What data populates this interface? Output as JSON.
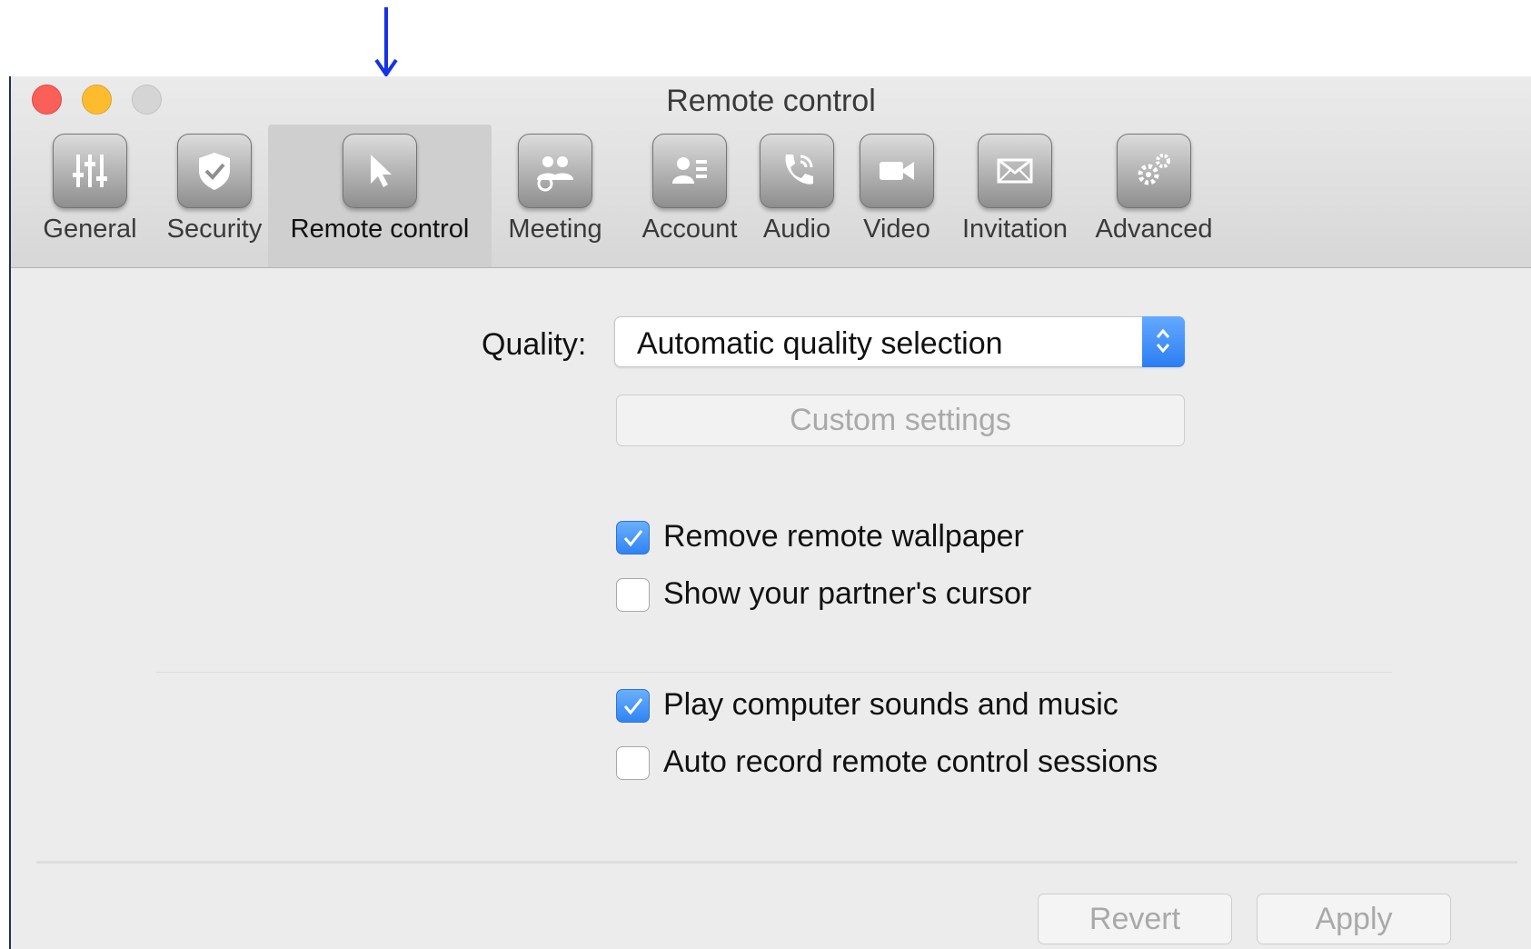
{
  "window": {
    "title": "Remote control"
  },
  "toolbar": {
    "items": [
      {
        "label": "General",
        "icon": "sliders-icon",
        "selected": false
      },
      {
        "label": "Security",
        "icon": "shield-icon",
        "selected": false
      },
      {
        "label": "Remote control",
        "icon": "cursor-icon",
        "selected": true
      },
      {
        "label": "Meeting",
        "icon": "group-icon",
        "selected": false
      },
      {
        "label": "Account",
        "icon": "contact-card-icon",
        "selected": false
      },
      {
        "label": "Audio",
        "icon": "phone-icon",
        "selected": false
      },
      {
        "label": "Video",
        "icon": "video-camera-icon",
        "selected": false
      },
      {
        "label": "Invitation",
        "icon": "envelope-icon",
        "selected": false
      },
      {
        "label": "Advanced",
        "icon": "gears-icon",
        "selected": false
      }
    ]
  },
  "quality": {
    "label": "Quality:",
    "selected_value": "Automatic quality selection"
  },
  "custom_settings_label": "Custom settings",
  "options": [
    {
      "label": "Remove remote wallpaper",
      "checked": true
    },
    {
      "label": "Show your partner's cursor",
      "checked": false
    },
    {
      "label": "Play computer sounds and music",
      "checked": true
    },
    {
      "label": "Auto record remote control sessions",
      "checked": false
    }
  ],
  "footer": {
    "revert_label": "Revert",
    "apply_label": "Apply"
  },
  "colors": {
    "accent": "#2f83f3",
    "annotation_arrow": "#1432e6"
  }
}
